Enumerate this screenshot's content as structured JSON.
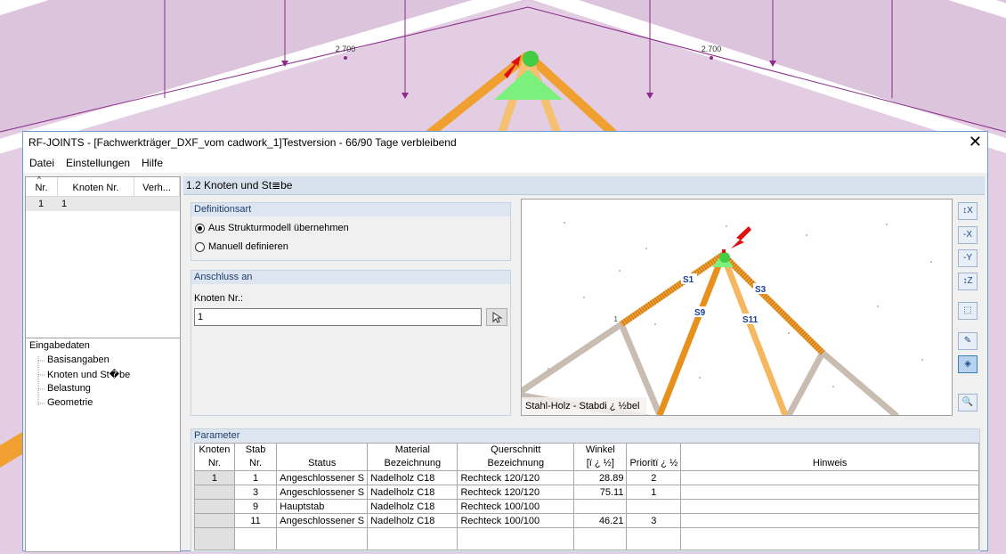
{
  "background": {
    "dim_left": "2.700",
    "dim_right": "2.700"
  },
  "window": {
    "title": "RF-JOINTS - [Fachwerkträger_DXF_vom cadwork_1]Testversion - 66/90 Tage verbleibend",
    "close_glyph": "✕"
  },
  "menu": {
    "items": [
      "Datei",
      "Einstellungen",
      "Hilfe"
    ]
  },
  "left_table": {
    "headers": [
      "Nr.",
      "Knoten Nr.",
      "Verh..."
    ],
    "rows": [
      [
        "1",
        "1",
        ""
      ]
    ]
  },
  "tree": {
    "root": "Eingabedaten",
    "items": [
      "Basisangaben",
      "Knoten und St�be",
      "Belastung",
      "Geometrie"
    ]
  },
  "section": {
    "title": "1.2 Knoten und St≣be"
  },
  "definitionsart": {
    "title": "Definitionsart",
    "options": [
      {
        "label": "Aus Strukturmodell übernehmen",
        "selected": true
      },
      {
        "label": "Manuell definieren",
        "selected": false
      }
    ]
  },
  "anschluss": {
    "title": "Anschluss an",
    "knoten_label": "Knoten Nr.:",
    "knoten_value": "1"
  },
  "viewport": {
    "caption": "Stahl-Holz - Stabdi ¿ ½bel",
    "node_label": "1",
    "members": [
      "S1",
      "S9",
      "S11",
      "S3"
    ]
  },
  "toolbar_icons": [
    "view-x-icon",
    "view-minus-x-icon",
    "view-minus-y-icon",
    "view-z-icon",
    "isometric-icon",
    "edit-icon",
    "render-icon",
    "zoom-icon"
  ],
  "parameter": {
    "title": "Parameter",
    "headers": [
      [
        "Knoten",
        "Nr."
      ],
      [
        "Stab",
        "Nr."
      ],
      [
        "",
        "Status"
      ],
      [
        "Material",
        "Bezeichnung"
      ],
      [
        "Querschnitt",
        "Bezeichnung"
      ],
      [
        "Winkel",
        "[ï ¿ ½]"
      ],
      [
        "",
        "Prioritï ¿ ½"
      ],
      [
        "",
        "Hinweis"
      ]
    ],
    "rows": [
      {
        "knoten": "1",
        "stab": "1",
        "status": "Angeschlossener S",
        "material": "Nadelholz C18",
        "querschnitt": "Rechteck 120/120",
        "winkel": "28.89",
        "prioritaet": "2",
        "hinweis": ""
      },
      {
        "knoten": "",
        "stab": "3",
        "status": "Angeschlossener S",
        "material": "Nadelholz C18",
        "querschnitt": "Rechteck 120/120",
        "winkel": "75.11",
        "prioritaet": "1",
        "hinweis": ""
      },
      {
        "knoten": "",
        "stab": "9",
        "status": "Hauptstab",
        "material": "Nadelholz C18",
        "querschnitt": "Rechteck 100/100",
        "winkel": "",
        "prioritaet": "",
        "hinweis": ""
      },
      {
        "knoten": "",
        "stab": "11",
        "status": "Angeschlossener S",
        "material": "Nadelholz C18",
        "querschnitt": "Rechteck 100/100",
        "winkel": "46.21",
        "prioritaet": "3",
        "hinweis": ""
      }
    ]
  },
  "colors": {
    "accent": "#1b4c8a",
    "member_orange": "#f0a030",
    "member_grey": "#c9bdb2",
    "node_green": "#7cf07c",
    "marker_red": "#e01010",
    "background_purple": "#e6cfe6"
  }
}
